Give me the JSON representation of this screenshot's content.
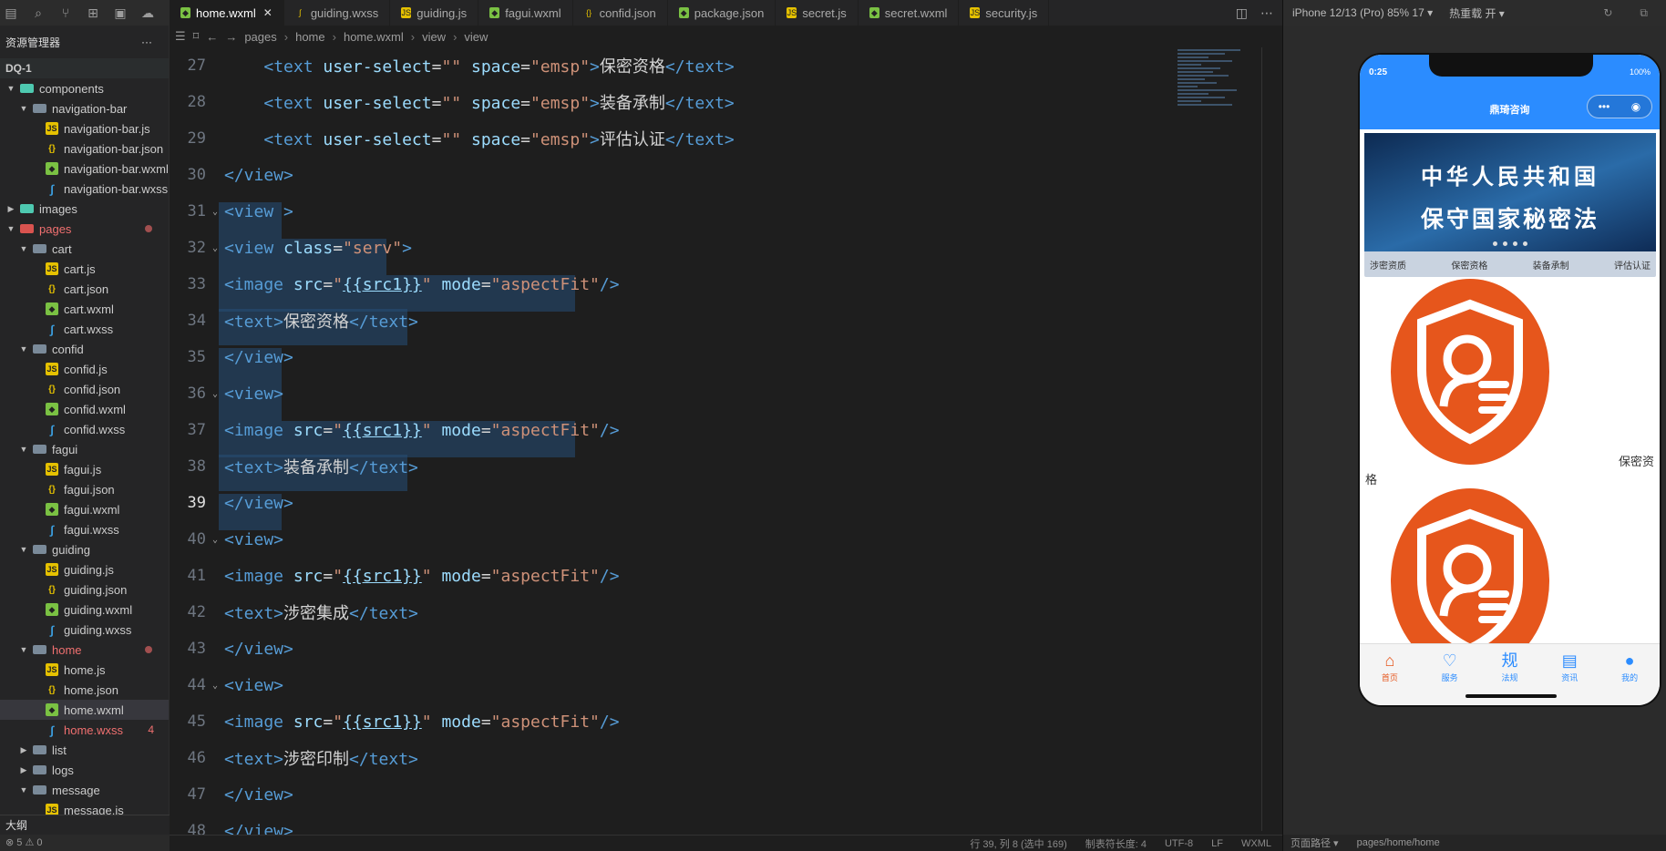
{
  "explorer": {
    "title": "资源管理器",
    "more": "···",
    "project": "DQ-1",
    "items": [
      {
        "label": "components",
        "depth": 0,
        "type": "fold-g",
        "open": true
      },
      {
        "label": "navigation-bar",
        "depth": 1,
        "type": "fold",
        "open": true
      },
      {
        "label": "navigation-bar.js",
        "depth": 2,
        "type": "js"
      },
      {
        "label": "navigation-bar.json",
        "depth": 2,
        "type": "json"
      },
      {
        "label": "navigation-bar.wxml",
        "depth": 2,
        "type": "wxml"
      },
      {
        "label": "navigation-bar.wxss",
        "depth": 2,
        "type": "wxss"
      },
      {
        "label": "images",
        "depth": 0,
        "type": "fold-g",
        "open": false
      },
      {
        "label": "pages",
        "depth": 0,
        "type": "fold-r",
        "open": true,
        "red": true,
        "dot": true
      },
      {
        "label": "cart",
        "depth": 1,
        "type": "fold",
        "open": true
      },
      {
        "label": "cart.js",
        "depth": 2,
        "type": "js"
      },
      {
        "label": "cart.json",
        "depth": 2,
        "type": "json"
      },
      {
        "label": "cart.wxml",
        "depth": 2,
        "type": "wxml"
      },
      {
        "label": "cart.wxss",
        "depth": 2,
        "type": "wxss"
      },
      {
        "label": "confid",
        "depth": 1,
        "type": "fold",
        "open": true
      },
      {
        "label": "confid.js",
        "depth": 2,
        "type": "js"
      },
      {
        "label": "confid.json",
        "depth": 2,
        "type": "json"
      },
      {
        "label": "confid.wxml",
        "depth": 2,
        "type": "wxml"
      },
      {
        "label": "confid.wxss",
        "depth": 2,
        "type": "wxss"
      },
      {
        "label": "fagui",
        "depth": 1,
        "type": "fold",
        "open": true
      },
      {
        "label": "fagui.js",
        "depth": 2,
        "type": "js"
      },
      {
        "label": "fagui.json",
        "depth": 2,
        "type": "json"
      },
      {
        "label": "fagui.wxml",
        "depth": 2,
        "type": "wxml"
      },
      {
        "label": "fagui.wxss",
        "depth": 2,
        "type": "wxss"
      },
      {
        "label": "guiding",
        "depth": 1,
        "type": "fold",
        "open": true
      },
      {
        "label": "guiding.js",
        "depth": 2,
        "type": "js"
      },
      {
        "label": "guiding.json",
        "depth": 2,
        "type": "json"
      },
      {
        "label": "guiding.wxml",
        "depth": 2,
        "type": "wxml"
      },
      {
        "label": "guiding.wxss",
        "depth": 2,
        "type": "wxss"
      },
      {
        "label": "home",
        "depth": 1,
        "type": "fold",
        "open": true,
        "red": true,
        "dot": true
      },
      {
        "label": "home.js",
        "depth": 2,
        "type": "js"
      },
      {
        "label": "home.json",
        "depth": 2,
        "type": "json"
      },
      {
        "label": "home.wxml",
        "depth": 2,
        "type": "wxml",
        "selected": true
      },
      {
        "label": "home.wxss",
        "depth": 2,
        "type": "wxss",
        "red": true,
        "count": "4"
      },
      {
        "label": "list",
        "depth": 1,
        "type": "fold",
        "open": false
      },
      {
        "label": "logs",
        "depth": 1,
        "type": "fold",
        "open": false
      },
      {
        "label": "message",
        "depth": 1,
        "type": "fold",
        "open": true
      },
      {
        "label": "message.js",
        "depth": 2,
        "type": "js"
      }
    ],
    "outline": "大纲",
    "problems": "⊗ 5 ⚠ 0"
  },
  "tabs": [
    {
      "label": "home.wxml",
      "type": "wxml",
      "active": true
    },
    {
      "label": "guiding.wxss",
      "type": "wxss"
    },
    {
      "label": "guiding.js",
      "type": "js"
    },
    {
      "label": "fagui.wxml",
      "type": "wxml"
    },
    {
      "label": "confid.json",
      "type": "json"
    },
    {
      "label": "package.json",
      "type": "wxml"
    },
    {
      "label": "secret.js",
      "type": "js"
    },
    {
      "label": "secret.wxml",
      "type": "wxml"
    },
    {
      "label": "security.js",
      "type": "js"
    }
  ],
  "breadcrumb": [
    "pages",
    "home",
    "home.wxml",
    "view",
    "view"
  ],
  "code": [
    {
      "n": "27",
      "indent": "    ",
      "parts": [
        [
          "t-tag",
          "<text "
        ],
        [
          "t-attr",
          "user-select"
        ],
        [
          "t-txt",
          "="
        ],
        [
          "t-str",
          "\"\""
        ],
        [
          "t-txt",
          " "
        ],
        [
          "t-attr",
          "space"
        ],
        [
          "t-txt",
          "="
        ],
        [
          "t-str",
          "\"emsp\""
        ],
        [
          "t-tag",
          ">"
        ],
        [
          "t-txt",
          "保密资格"
        ],
        [
          "t-tag",
          "</text>"
        ]
      ]
    },
    {
      "n": "28",
      "indent": "    ",
      "parts": [
        [
          "t-tag",
          "<text "
        ],
        [
          "t-attr",
          "user-select"
        ],
        [
          "t-txt",
          "="
        ],
        [
          "t-str",
          "\"\""
        ],
        [
          "t-txt",
          " "
        ],
        [
          "t-attr",
          "space"
        ],
        [
          "t-txt",
          "="
        ],
        [
          "t-str",
          "\"emsp\""
        ],
        [
          "t-tag",
          ">"
        ],
        [
          "t-txt",
          "装备承制"
        ],
        [
          "t-tag",
          "</text>"
        ]
      ]
    },
    {
      "n": "29",
      "indent": "    ",
      "parts": [
        [
          "t-tag",
          "<text "
        ],
        [
          "t-attr",
          "user-select"
        ],
        [
          "t-txt",
          "="
        ],
        [
          "t-str",
          "\"\""
        ],
        [
          "t-txt",
          " "
        ],
        [
          "t-attr",
          "space"
        ],
        [
          "t-txt",
          "="
        ],
        [
          "t-str",
          "\"emsp\""
        ],
        [
          "t-tag",
          ">"
        ],
        [
          "t-txt",
          "评估认证"
        ],
        [
          "t-tag",
          "</text>"
        ]
      ]
    },
    {
      "n": "30",
      "parts": [
        [
          "t-tag",
          "</view>"
        ]
      ]
    },
    {
      "n": "31",
      "fold": true,
      "hl": 3,
      "parts": [
        [
          "t-tag",
          "<view >"
        ]
      ]
    },
    {
      "n": "32",
      "fold": true,
      "hl": 8,
      "parts": [
        [
          "t-tag",
          "<view "
        ],
        [
          "t-attr",
          "class"
        ],
        [
          "t-txt",
          "="
        ],
        [
          "t-str",
          "\"serv\""
        ],
        [
          "t-tag",
          ">"
        ]
      ]
    },
    {
      "n": "33",
      "hl": 17,
      "parts": [
        [
          "t-tag",
          "<image "
        ],
        [
          "t-attr",
          "src"
        ],
        [
          "t-txt",
          "="
        ],
        [
          "t-str",
          "\""
        ],
        [
          "t-mus",
          "{{src1}}"
        ],
        [
          "t-str",
          "\""
        ],
        [
          "t-txt",
          " "
        ],
        [
          "t-attr",
          "mode"
        ],
        [
          "t-txt",
          "="
        ],
        [
          "t-str",
          "\"aspectFit\""
        ],
        [
          "t-tag",
          "/>"
        ]
      ]
    },
    {
      "n": "34",
      "hl": 9,
      "parts": [
        [
          "t-tag",
          "<text>"
        ],
        [
          "t-txt",
          "保密资格"
        ],
        [
          "t-tag",
          "</text>"
        ]
      ]
    },
    {
      "n": "35",
      "hl": 3,
      "parts": [
        [
          "t-tag",
          "</view>"
        ]
      ]
    },
    {
      "n": "36",
      "fold": true,
      "hl": 3,
      "parts": [
        [
          "t-tag",
          "<view>"
        ]
      ]
    },
    {
      "n": "37",
      "hl": 17,
      "parts": [
        [
          "t-tag",
          "<image "
        ],
        [
          "t-attr",
          "src"
        ],
        [
          "t-txt",
          "="
        ],
        [
          "t-str",
          "\""
        ],
        [
          "t-mus",
          "{{src1}}"
        ],
        [
          "t-str",
          "\""
        ],
        [
          "t-txt",
          " "
        ],
        [
          "t-attr",
          "mode"
        ],
        [
          "t-txt",
          "="
        ],
        [
          "t-str",
          "\"aspectFit\""
        ],
        [
          "t-tag",
          "/>"
        ]
      ]
    },
    {
      "n": "38",
      "hl": 9,
      "parts": [
        [
          "t-tag",
          "<text>"
        ],
        [
          "t-txt",
          "装备承制"
        ],
        [
          "t-tag",
          "</text>"
        ]
      ]
    },
    {
      "n": "39",
      "cur": true,
      "hl": 3,
      "parts": [
        [
          "t-tag",
          "</view>"
        ]
      ]
    },
    {
      "n": "40",
      "fold": true,
      "parts": [
        [
          "t-tag",
          "<view>"
        ]
      ]
    },
    {
      "n": "41",
      "parts": [
        [
          "t-tag",
          "<image "
        ],
        [
          "t-attr",
          "src"
        ],
        [
          "t-txt",
          "="
        ],
        [
          "t-str",
          "\""
        ],
        [
          "t-mus",
          "{{src1}}"
        ],
        [
          "t-str",
          "\""
        ],
        [
          "t-txt",
          " "
        ],
        [
          "t-attr",
          "mode"
        ],
        [
          "t-txt",
          "="
        ],
        [
          "t-str",
          "\"aspectFit\""
        ],
        [
          "t-tag",
          "/>"
        ]
      ]
    },
    {
      "n": "42",
      "parts": [
        [
          "t-tag",
          "<text>"
        ],
        [
          "t-txt",
          "涉密集成"
        ],
        [
          "t-tag",
          "</text>"
        ]
      ]
    },
    {
      "n": "43",
      "parts": [
        [
          "t-tag",
          "</view>"
        ]
      ]
    },
    {
      "n": "44",
      "fold": true,
      "parts": [
        [
          "t-tag",
          "<view>"
        ]
      ]
    },
    {
      "n": "45",
      "parts": [
        [
          "t-tag",
          "<image "
        ],
        [
          "t-attr",
          "src"
        ],
        [
          "t-txt",
          "="
        ],
        [
          "t-str",
          "\""
        ],
        [
          "t-mus",
          "{{src1}}"
        ],
        [
          "t-str",
          "\""
        ],
        [
          "t-txt",
          " "
        ],
        [
          "t-attr",
          "mode"
        ],
        [
          "t-txt",
          "="
        ],
        [
          "t-str",
          "\"aspectFit\""
        ],
        [
          "t-tag",
          "/>"
        ]
      ]
    },
    {
      "n": "46",
      "parts": [
        [
          "t-tag",
          "<text>"
        ],
        [
          "t-txt",
          "涉密印制"
        ],
        [
          "t-tag",
          "</text>"
        ]
      ]
    },
    {
      "n": "47",
      "parts": [
        [
          "t-tag",
          "</view>"
        ]
      ]
    },
    {
      "n": "48",
      "parts": [
        [
          "t-tag",
          "</view>"
        ]
      ]
    }
  ],
  "editor_status": [
    "行 39, 列 8 (选中 169)",
    "制表符长度: 4",
    "UTF-8",
    "LF",
    "WXML"
  ],
  "simulator": {
    "device": "iPhone 12/13 (Pro) 85% 17 ▾",
    "hotreload": "热重载 开 ▾",
    "time": "0:25",
    "battery": "100%",
    "title": "鼎琦咨询",
    "capsule_more": "•••",
    "capsule_close": "◉",
    "banner_line1": "中华人民共和国",
    "banner_line2": "保守国家秘密法",
    "banner_items": [
      "涉密资质",
      "保密资格",
      "装备承制",
      "评估认证"
    ],
    "service_label_right": "保密资",
    "service_label_left": "格",
    "tabbar": [
      {
        "label": "首页",
        "icon": "⌂",
        "active": true
      },
      {
        "label": "服务",
        "icon": "♡"
      },
      {
        "label": "法规",
        "icon": "规"
      },
      {
        "label": "资讯",
        "icon": "▤"
      },
      {
        "label": "我的",
        "icon": "●"
      }
    ],
    "path_label": "页面路径 ▾",
    "path": "pages/home/home"
  }
}
